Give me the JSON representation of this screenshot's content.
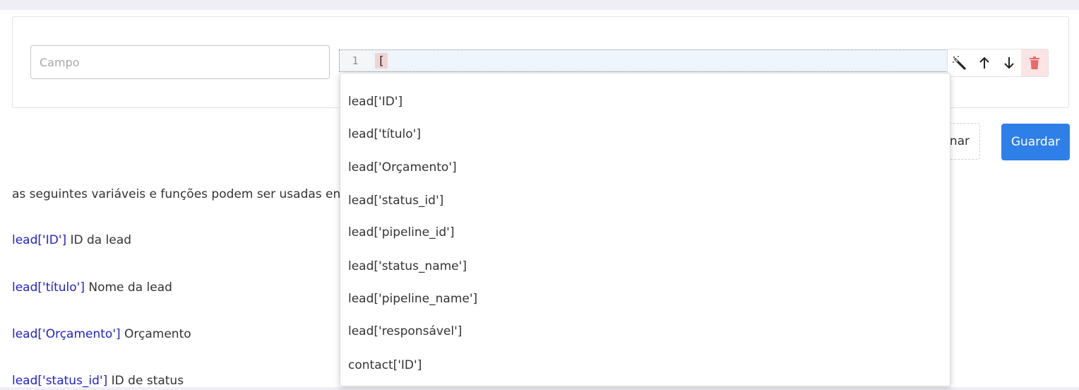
{
  "form": {
    "campo_placeholder": "Campo",
    "campo_value": "",
    "editor": {
      "line_number": "1",
      "code": "["
    },
    "tools": {
      "magic_icon": "magic-wand-icon",
      "up_icon": "arrow-up-icon",
      "down_icon": "arrow-down-icon",
      "delete_icon": "trash-icon"
    }
  },
  "actions": {
    "secondary_label": "nar",
    "save_label": "Guardar",
    "save_color": "#2f7fe8"
  },
  "help": {
    "intro": "as seguintes variáveis e funções podem ser usadas en",
    "variables": [
      {
        "var": "lead['ID']",
        "desc": " ID da lead"
      },
      {
        "var": "lead['título']",
        "desc": " Nome da lead"
      },
      {
        "var": "lead['Orçamento']",
        "desc": " Orçamento"
      },
      {
        "var": "lead['status_id']",
        "desc": " ID de status"
      }
    ]
  },
  "autocomplete": {
    "items": [
      "lead['ID']",
      "lead['título']",
      "lead['Orçamento']",
      "lead['status_id']",
      "lead['pipeline_id']",
      "lead['status_name']",
      "lead['pipeline_name']",
      "lead['responsável']",
      "contact['ID']"
    ]
  }
}
